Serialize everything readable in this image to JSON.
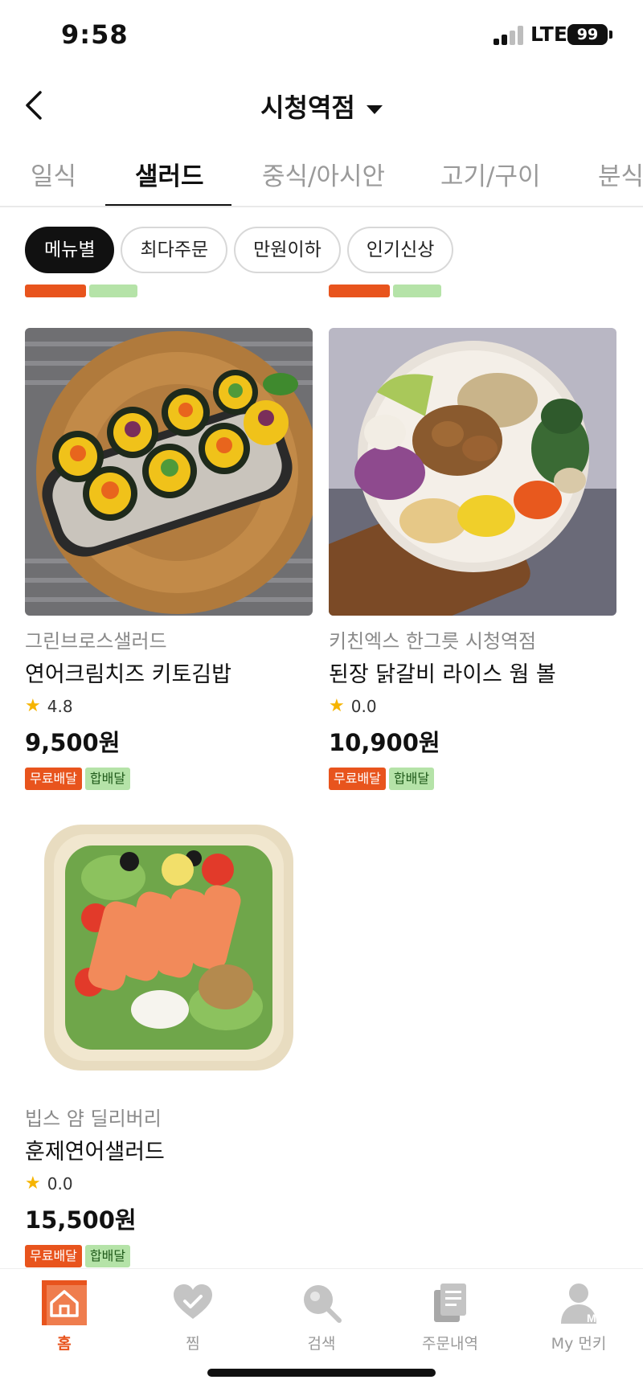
{
  "status_bar": {
    "time": "9:58",
    "network": "LTE",
    "battery": "99"
  },
  "header": {
    "title": "시청역점"
  },
  "tabs": [
    {
      "label": "일식",
      "active": false
    },
    {
      "label": "샐러드",
      "active": true
    },
    {
      "label": "중식/아시안",
      "active": false
    },
    {
      "label": "고기/구이",
      "active": false
    },
    {
      "label": "분식",
      "active": false
    }
  ],
  "chips": [
    {
      "label": "메뉴별",
      "active": true
    },
    {
      "label": "최다주문",
      "active": false
    },
    {
      "label": "만원이하",
      "active": false
    },
    {
      "label": "인기신상",
      "active": false
    }
  ],
  "products": [
    {
      "store": "그린브로스샐러드",
      "name": "연어크림치즈 키토김밥",
      "rating": "4.8",
      "price": "9,500원",
      "badges": [
        "무료배달",
        "합배달"
      ]
    },
    {
      "store": "키친엑스 한그릇 시청역점",
      "name": "된장 닭갈비 라이스 웜 볼",
      "rating": "0.0",
      "price": "10,900원",
      "badges": [
        "무료배달",
        "합배달"
      ]
    },
    {
      "store": "빕스 얌 딜리버리",
      "name": "훈제연어샐러드",
      "rating": "0.0",
      "price": "15,500원",
      "badges": [
        "무료배달",
        "합배달"
      ]
    }
  ],
  "bottom_nav": [
    {
      "label": "홈",
      "icon": "home-icon",
      "active": true
    },
    {
      "label": "찜",
      "icon": "heart-icon",
      "active": false
    },
    {
      "label": "검색",
      "icon": "search-icon",
      "active": false
    },
    {
      "label": "주문내역",
      "icon": "order-history-icon",
      "active": false
    },
    {
      "label": "My 먼키",
      "icon": "profile-icon",
      "active": false
    }
  ],
  "colors": {
    "accent": "#e8541d",
    "combo_badge": "#b5e3a8",
    "star": "#f6b400"
  }
}
